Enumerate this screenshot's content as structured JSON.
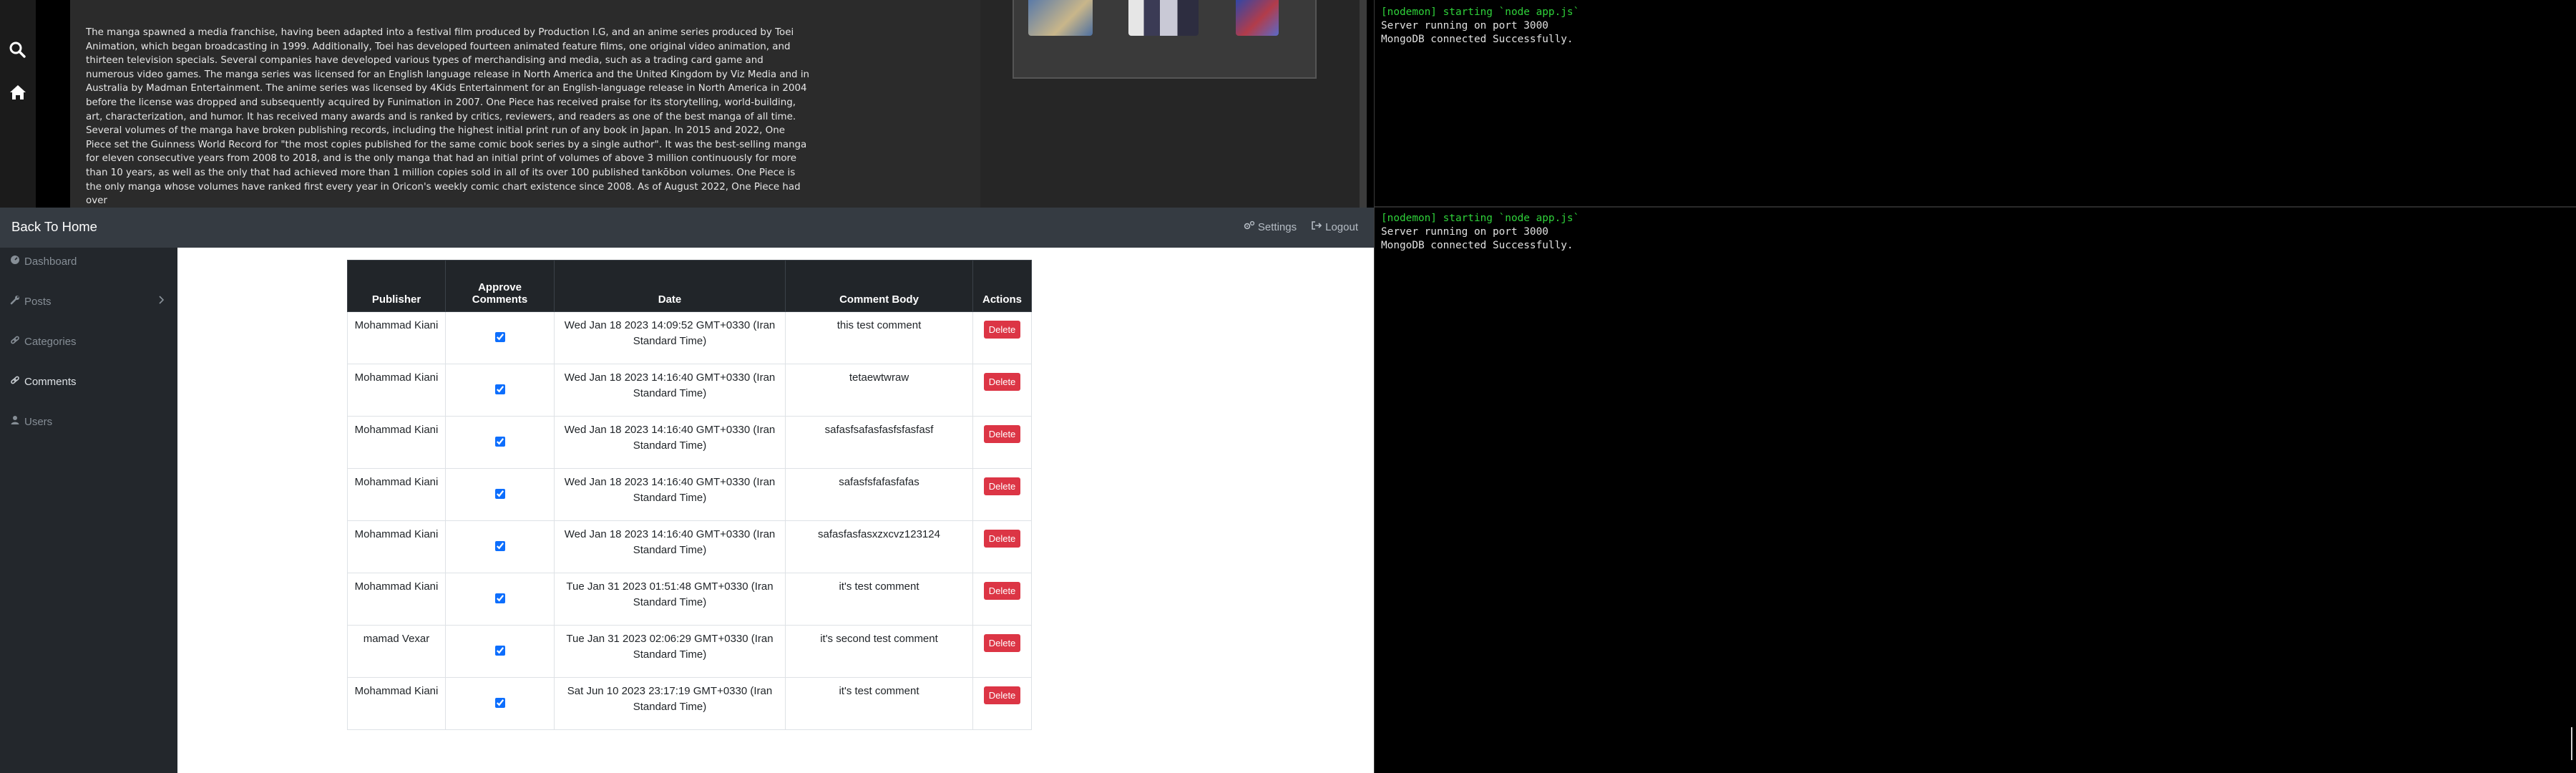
{
  "blog": {
    "article_text": "The manga spawned a media franchise, having been adapted into a festival film produced by Production I.G, and an anime series produced by Toei Animation, which began broadcasting in 1999. Additionally, Toei has developed fourteen animated feature films, one original video animation, and thirteen television specials. Several companies have developed various types of merchandising and media, such as a trading card game and numerous video games. The manga series was licensed for an English language release in North America and the United Kingdom by Viz Media and in Australia by Madman Entertainment. The anime series was licensed by 4Kids Entertainment for an English-language release in North America in 2004 before the license was dropped and subsequently acquired by Funimation in 2007. One Piece has received praise for its storytelling, world-building, art, characterization, and humor. It has received many awards and is ranked by critics, reviewers, and readers as one of the best manga of all time. Several volumes of the manga have broken publishing records, including the highest initial print run of any book in Japan. In 2015 and 2022, One Piece set the Guinness World Record for \"the most copies published for the same comic book series by a single author\". It was the best-selling manga for eleven consecutive years from 2008 to 2018, and is the only manga that had an initial print of volumes of above 3 million continuously for more than 10 years, as well as the only that had achieved more than 1 million copies sold in all of its over 100 published tankōbon volumes. One Piece is the only manga whose volumes have ranked first every year in Oricon's weekly comic chart existence since 2008. As of August 2022, One Piece had over",
    "rail_icons": [
      "search-icon",
      "home-icon"
    ]
  },
  "terminal": {
    "block1": {
      "line1": "[nodemon] starting `node app.js`",
      "line2": "Server running on port 3000",
      "line3": "MongoDB connected Successfully."
    },
    "block2": {
      "line1": "[nodemon] starting `node app.js`",
      "line2": "Server running on port 3000",
      "line3": "MongoDB connected Successfully."
    },
    "colors": {
      "nodemon": "#2fd23a",
      "text": "#e0e0e0"
    }
  },
  "admin": {
    "back_home": "Back To Home",
    "settings": "Settings",
    "logout": "Logout",
    "sidebar": {
      "dashboard": "Dashboard",
      "posts": "Posts",
      "categories": "Categories",
      "comments": "Comments",
      "users": "Users",
      "active": "Comments"
    },
    "table": {
      "headers": {
        "publisher": "Publisher",
        "approve": "Approve Comments",
        "date": "Date",
        "body": "Comment Body",
        "actions": "Actions"
      },
      "delete_label": "Delete",
      "rows": [
        {
          "publisher": "Mohammad Kiani",
          "approved": true,
          "date": "Wed Jan 18 2023 14:09:52 GMT+0330 (Iran Standard Time)",
          "body": "this test comment"
        },
        {
          "publisher": "Mohammad Kiani",
          "approved": true,
          "date": "Wed Jan 18 2023 14:16:40 GMT+0330 (Iran Standard Time)",
          "body": "tetaewtwraw"
        },
        {
          "publisher": "Mohammad Kiani",
          "approved": true,
          "date": "Wed Jan 18 2023 14:16:40 GMT+0330 (Iran Standard Time)",
          "body": "safasfsafasfasfsfasfasf"
        },
        {
          "publisher": "Mohammad Kiani",
          "approved": true,
          "date": "Wed Jan 18 2023 14:16:40 GMT+0330 (Iran Standard Time)",
          "body": "safasfsfafasfafas"
        },
        {
          "publisher": "Mohammad Kiani",
          "approved": true,
          "date": "Wed Jan 18 2023 14:16:40 GMT+0330 (Iran Standard Time)",
          "body": "safasfasfasxzxcvz123124"
        },
        {
          "publisher": "Mohammad Kiani",
          "approved": true,
          "date": "Tue Jan 31 2023 01:51:48 GMT+0330 (Iran Standard Time)",
          "body": "it's test comment"
        },
        {
          "publisher": "mamad Vexar",
          "approved": true,
          "date": "Tue Jan 31 2023 02:06:29 GMT+0330 (Iran Standard Time)",
          "body": "it's second test comment"
        },
        {
          "publisher": "Mohammad Kiani",
          "approved": true,
          "date": "Sat Jun 10 2023 23:17:19 GMT+0330 (Iran Standard Time)",
          "body": "it's test comment"
        }
      ]
    },
    "colors": {
      "topbar": "#353b42",
      "sidebar": "#23272c",
      "table_header": "#212529",
      "delete": "#dc3545"
    }
  }
}
